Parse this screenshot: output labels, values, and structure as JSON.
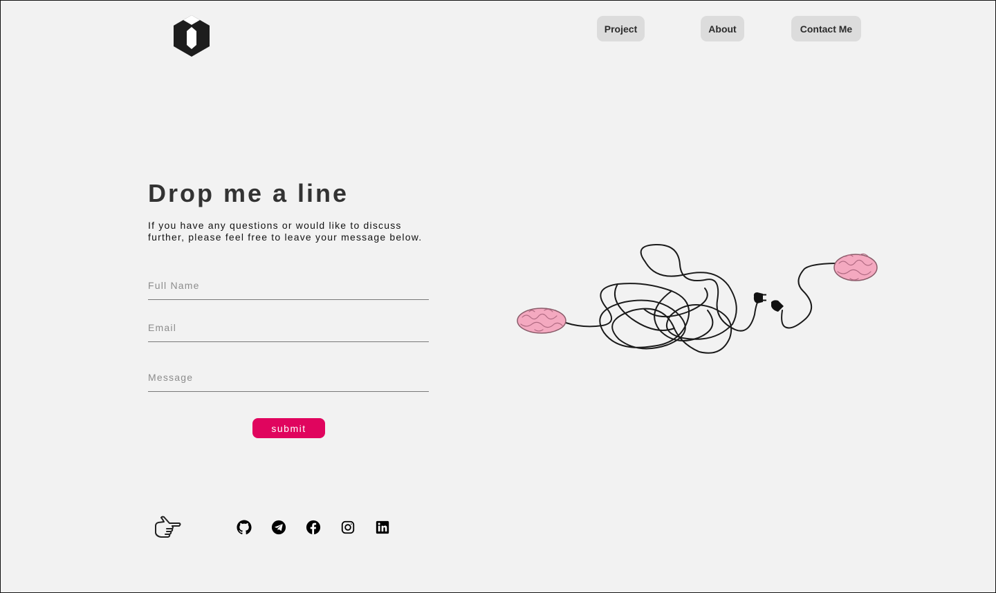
{
  "nav": {
    "project": "Project",
    "about": "About",
    "contact": "Contact Me"
  },
  "contact": {
    "title": "Drop me a line",
    "intro": "If you have any questions or would like to discuss further, please feel free to leave your message below.",
    "fields": {
      "full_name": "Full Name",
      "email": "Email",
      "message": "Message"
    },
    "submit_label": "submit"
  },
  "social": [
    "github-icon",
    "telegram-icon",
    "facebook-icon",
    "instagram-icon",
    "linkedin-icon"
  ],
  "colors": {
    "background": "#f2f2f2",
    "accent": "#e0055e",
    "nav_button": "#dcdcdc",
    "brain_pink": "#f4a9c0"
  }
}
